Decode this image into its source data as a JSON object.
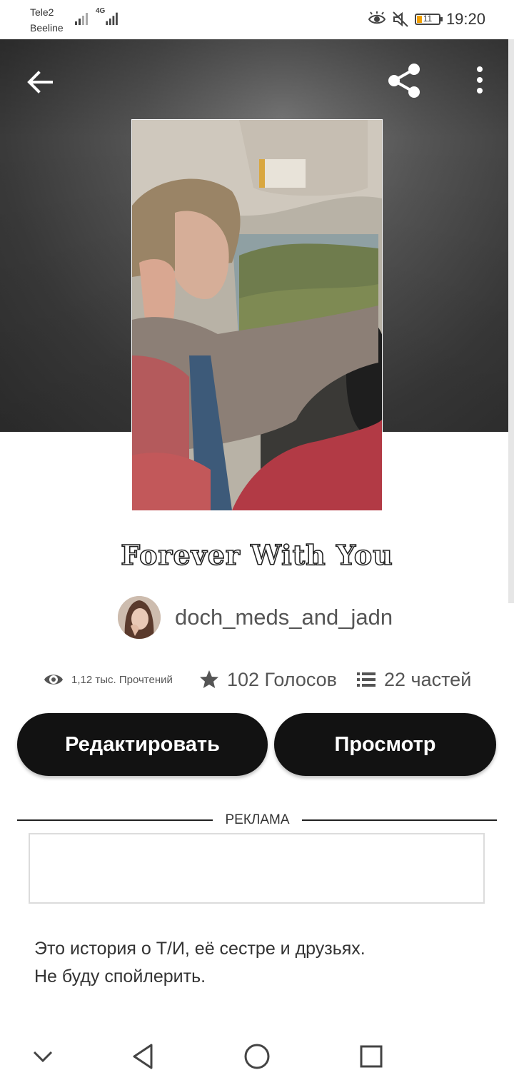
{
  "status_bar": {
    "carrier_1": "Tele2",
    "carrier_2": "Beeline",
    "network": "4G",
    "battery_level": "11",
    "time": "19:20",
    "icons": [
      "eye-icon",
      "mute-icon",
      "battery-icon"
    ]
  },
  "header": {
    "back_icon": "arrow-left-icon",
    "share_icon": "share-icon",
    "more_icon": "more-vertical-icon"
  },
  "story": {
    "title": "Forever With You",
    "author": "doch_meds_and_jadn",
    "stats": {
      "reads": "1,12 тыс. Прочтений",
      "votes": "102 Голосов",
      "parts": "22 частей"
    },
    "description_line_1": "Это история о Т/И, её сестре и друзьях.",
    "description_line_2": "Не буду спойлерить."
  },
  "actions": {
    "edit_label": "Редактировать",
    "preview_label": "Просмотр"
  },
  "ad": {
    "label": "РЕКЛАМА"
  },
  "nav": {
    "icons": [
      "chevron-down-icon",
      "back-triangle-icon",
      "home-circle-icon",
      "recents-square-icon"
    ]
  },
  "colors": {
    "button_bg": "#121212",
    "battery_fill": "#f2a000",
    "header_bg": "#3a3a3a"
  }
}
